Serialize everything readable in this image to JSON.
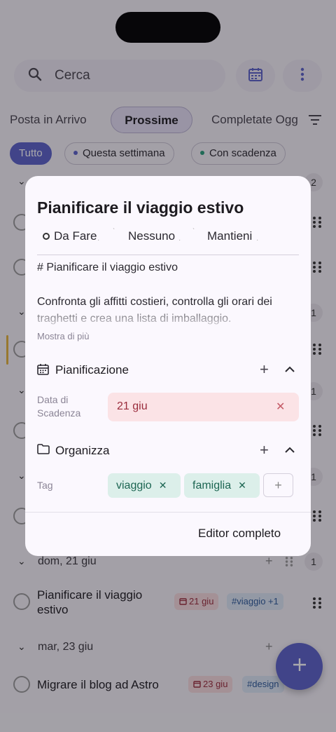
{
  "search": {
    "placeholder": "Cerca"
  },
  "tabs": [
    {
      "label": "Posta in Arrivo"
    },
    {
      "label": "Prossime"
    },
    {
      "label": "Completate Ogg"
    }
  ],
  "filters": [
    {
      "label": "Tutto"
    },
    {
      "label": "Questa settimana",
      "dot_color": "#5b62c9"
    },
    {
      "label": "Con scadenza",
      "dot_color": "#2a9d7a"
    }
  ],
  "background": {
    "badges": [
      "2",
      "1",
      "1",
      "1"
    ],
    "groups": [
      {
        "date": "dom, 21 giu",
        "count": "1",
        "task": {
          "title": "Pianificare il viaggio estivo",
          "date": "21 giu",
          "tag": "#viaggio +1"
        }
      },
      {
        "date": "mar, 23 giu",
        "task": {
          "title": "Migrare il blog ad Astro",
          "date": "23 giu",
          "tag": "#design"
        }
      }
    ]
  },
  "modal": {
    "title": "Pianificare il viaggio estivo",
    "status": "Da Fare",
    "priority": "Nessuno",
    "recurrence": "Mantieni",
    "description_heading": "# Pianificare il viaggio estivo",
    "description_body": "Confronta gli affitti costieri, controlla gli orari dei traghetti e crea una lista di imballaggio.",
    "show_more": "Mostra di più",
    "scheduling": {
      "label": "Pianificazione",
      "due_label_line1": "Data di",
      "due_label_line2": "Scadenza",
      "due_value": "21 giu"
    },
    "organize": {
      "label": "Organizza",
      "tag_label": "Tag",
      "tags": [
        "viaggio",
        "famiglia"
      ]
    },
    "full_editor": "Editor completo"
  },
  "colors": {
    "accent": "#5b62c9",
    "due_bg": "#fbe3e6",
    "tag_bg": "#dcefea"
  }
}
